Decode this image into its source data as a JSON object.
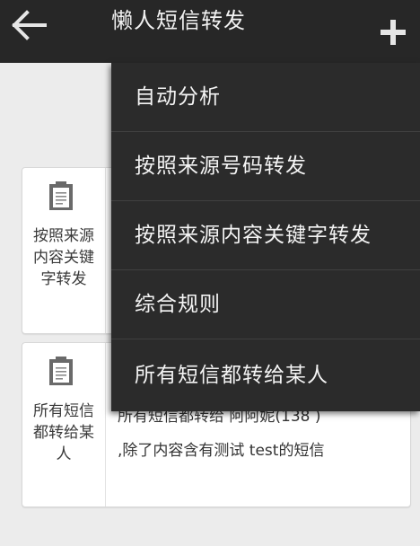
{
  "appbar": {
    "title": "懒人短信转发",
    "back_icon": "arrow-left-icon",
    "add_icon": "plus-icon"
  },
  "menu": {
    "items": [
      {
        "label": "自动分析"
      },
      {
        "label": "按照来源号码转发"
      },
      {
        "label": "按照来源内容关键字转发"
      },
      {
        "label": "综合规则"
      },
      {
        "label": "所有短信都转给某人"
      }
    ]
  },
  "rules": [
    {
      "icon": "clipboard-icon",
      "type": "按照来源内容关键字转发",
      "description": ""
    },
    {
      "icon": "clipboard-icon",
      "type": "所有短信都转给某人",
      "description_line1": "所有短信都转给 阿阿妮(138 )",
      "description_line2": ",除了内容含有测试 test的短信"
    }
  ],
  "colors": {
    "appbar_bg": "#272727",
    "menu_bg": "#2b2b2b",
    "page_bg": "#ececec"
  }
}
